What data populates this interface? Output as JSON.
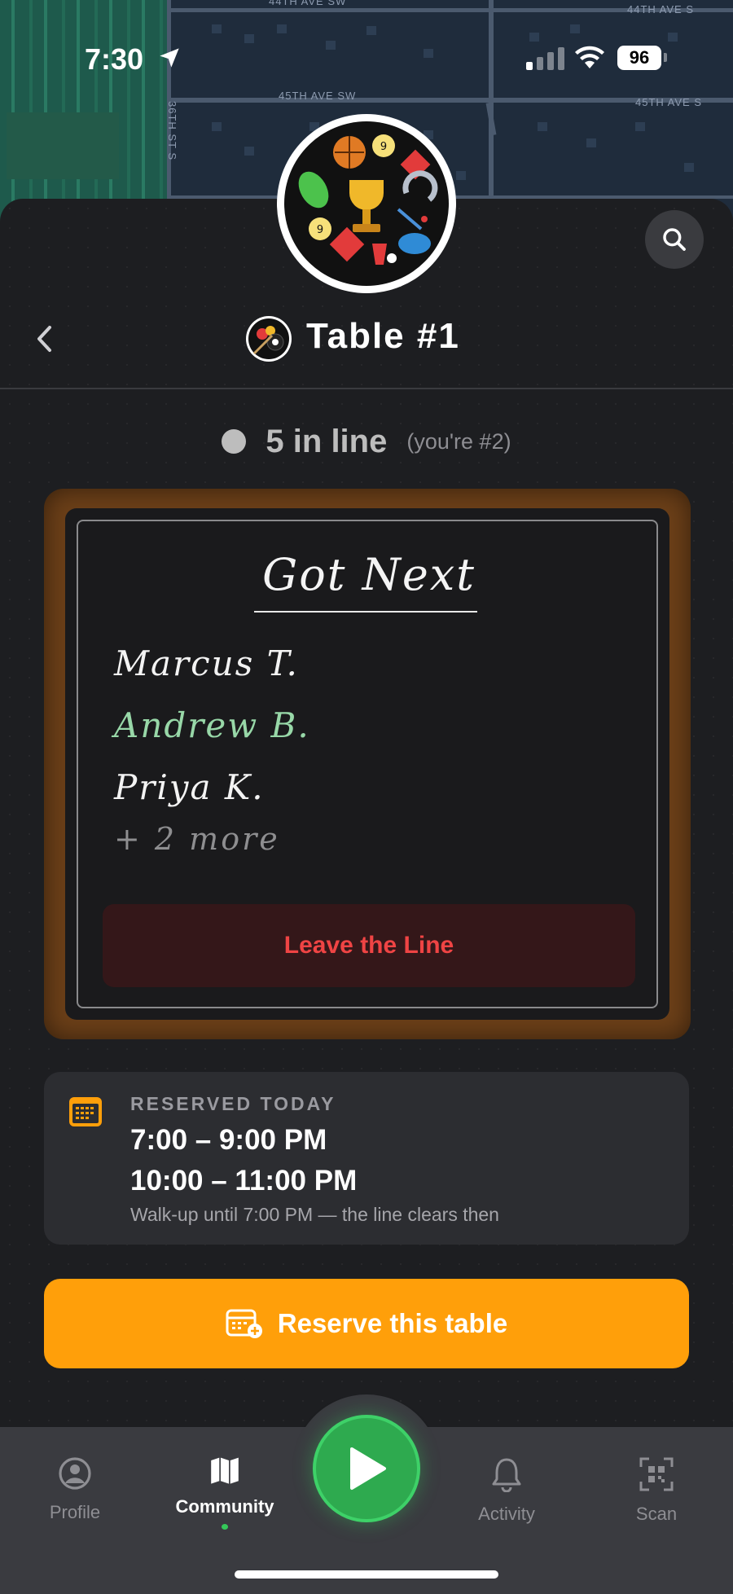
{
  "status_bar": {
    "time": "7:30",
    "battery": "96"
  },
  "map": {
    "labels": [
      "44TH AVE SW",
      "44TH AVE S",
      "45TH AVE SW",
      "45TH AVE S",
      "36TH ST S"
    ]
  },
  "header": {
    "title": "Table #1"
  },
  "queue": {
    "count_text": "5 in line",
    "position_text": "(you're #2)"
  },
  "board": {
    "title": "Got Next",
    "names": [
      "Marcus T.",
      "Andrew B.",
      "Priya K."
    ],
    "more": "+ 2 more",
    "leave_label": "Leave the Line"
  },
  "reserved": {
    "label": "RESERVED TODAY",
    "times": [
      "7:00 – 9:00 PM",
      "10:00 – 11:00 PM"
    ],
    "note": "Walk-up until 7:00 PM — the line clears then"
  },
  "reserve_button": {
    "label": "Reserve this table"
  },
  "tabs": [
    {
      "label": "Profile",
      "icon": "person-circle-icon"
    },
    {
      "label": "Community",
      "icon": "map-icon",
      "active": true
    },
    {
      "label": "Activity",
      "icon": "bell-icon"
    },
    {
      "label": "Scan",
      "icon": "qr-scan-icon"
    }
  ],
  "colors": {
    "accent": "#ff9f0a",
    "leave": "#ef4444",
    "play": "#2eaa4f",
    "current_user": "#98d8a8"
  }
}
